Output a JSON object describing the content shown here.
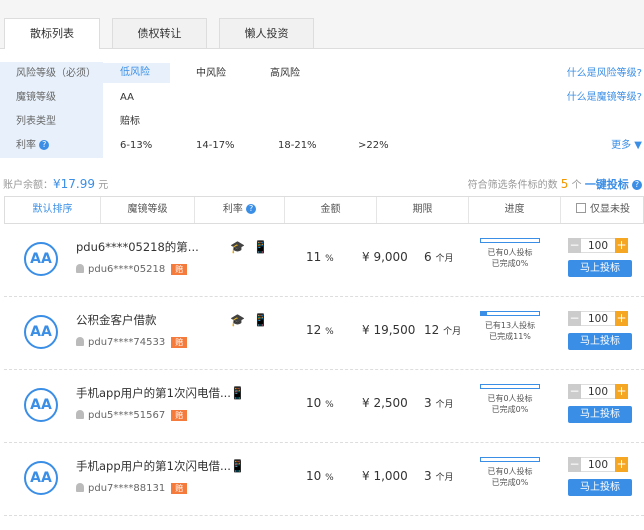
{
  "tabs": [
    "散标列表",
    "债权转让",
    "懒人投资"
  ],
  "filters": {
    "risk": {
      "label": "风险等级（必须）",
      "options": [
        "低风险",
        "中风险",
        "高风险"
      ],
      "help": "什么是风险等级?"
    },
    "grade": {
      "label": "魔镜等级",
      "value": "AA",
      "help": "什么是魔镜等级?"
    },
    "type": {
      "label": "列表类型",
      "value": "赔标"
    },
    "rate": {
      "label": "利率",
      "options": [
        "6-13%",
        "14-17%",
        "18-21%",
        ">22%"
      ],
      "more": "更多"
    }
  },
  "balance": {
    "label": "账户余额：",
    "amount": "¥17.99",
    "unit": "元"
  },
  "match": {
    "prefix": "符合筛选条件标的数",
    "count": "5",
    "unit": "个",
    "onekey": "一键投标"
  },
  "columns": [
    "默认排序",
    "魔镜等级",
    "利率",
    "金额",
    "期限",
    "进度",
    "仅显未投"
  ],
  "loans": [
    {
      "grade": "AA",
      "title": "pdu6****05218的第...",
      "user": "pdu6****05218",
      "badge": "赔",
      "icons": [
        "grad",
        "phone"
      ],
      "rate": "11",
      "rate_unit": "%",
      "amount": "¥ 9,000",
      "period": "6",
      "period_unit": "个月",
      "progress_pct": 0,
      "invest_text": "已有0人投标",
      "done_text": "已完成0%",
      "qty": "100",
      "button": "马上投标"
    },
    {
      "grade": "AA",
      "title": "公积金客户借款",
      "user": "pdu7****74533",
      "badge": "赔",
      "icons": [
        "grad",
        "phone"
      ],
      "rate": "12",
      "rate_unit": "%",
      "amount": "¥ 19,500",
      "period": "12",
      "period_unit": "个月",
      "progress_pct": 11,
      "invest_text": "已有13人投标",
      "done_text": "已完成11%",
      "qty": "100",
      "button": "马上投标"
    },
    {
      "grade": "AA",
      "title": "手机app用户的第1次闪电借...",
      "user": "pdu5****51567",
      "badge": "赔",
      "icons": [
        "phone"
      ],
      "rate": "10",
      "rate_unit": "%",
      "amount": "¥ 2,500",
      "period": "3",
      "period_unit": "个月",
      "progress_pct": 0,
      "invest_text": "已有0人投标",
      "done_text": "已完成0%",
      "qty": "100",
      "button": "马上投标"
    },
    {
      "grade": "AA",
      "title": "手机app用户的第1次闪电借...",
      "user": "pdu7****88131",
      "badge": "赔",
      "icons": [
        "phone"
      ],
      "rate": "10",
      "rate_unit": "%",
      "amount": "¥ 1,000",
      "period": "3",
      "period_unit": "个月",
      "progress_pct": 0,
      "invest_text": "已有0人投标",
      "done_text": "已完成0%",
      "qty": "100",
      "button": "马上投标"
    }
  ],
  "colors": {
    "accent": "#3a8ee6",
    "badge": "#f47b3c",
    "plus": "#f5a623"
  }
}
